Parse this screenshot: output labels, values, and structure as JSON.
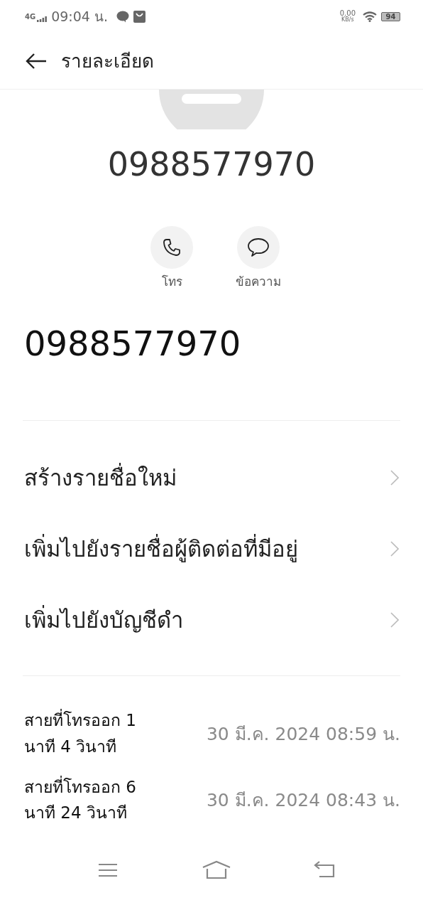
{
  "status_bar": {
    "network": "4G",
    "time": "09:04 น.",
    "speed": "0.00",
    "speed_unit": "KB/s",
    "battery": "94"
  },
  "header": {
    "title": "รายละเอียด"
  },
  "contact": {
    "name": "0988577970"
  },
  "actions": [
    {
      "kind": "call",
      "label": "โทร"
    },
    {
      "kind": "message",
      "label": "ข้อความ"
    }
  ],
  "phone_number": "0988577970",
  "menu_items": [
    {
      "label": "สร้างรายชื่อใหม่"
    },
    {
      "label": "เพิ่มไปยังรายชื่อผู้ติดต่อที่มีอยู่"
    },
    {
      "label": "เพิ่มไปยังบัญชีดำ"
    }
  ],
  "call_log": [
    {
      "description": "สายที่โทรออก 1 นาที 4 วินาที",
      "timestamp": "30 มี.ค. 2024 08:59 น."
    },
    {
      "description": "สายที่โทรออก 6 นาที 24 วินาที",
      "timestamp": "30 มี.ค. 2024 08:43 น."
    }
  ]
}
